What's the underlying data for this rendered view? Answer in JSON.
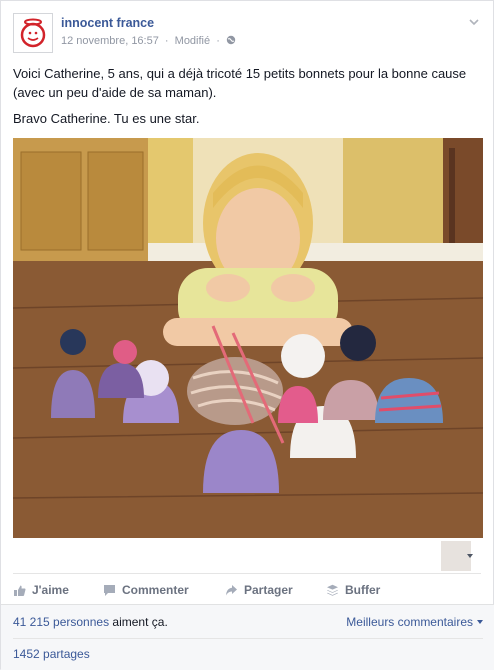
{
  "post": {
    "page_name": "innocent france",
    "timestamp": "12 novembre, 16:57",
    "separator": "·",
    "edited": "Modifié",
    "text_lines": [
      "Voici Catherine, 5 ans, qui a déjà tricoté 15 petits bonnets pour la bonne cause (avec un peu d'aide de sa maman).",
      "Bravo Catherine. Tu es une star."
    ]
  },
  "actions": [
    {
      "label": "J'aime",
      "icon": "thumbs-up-icon"
    },
    {
      "label": "Commenter",
      "icon": "comment-icon"
    },
    {
      "label": "Partager",
      "icon": "share-arrow-icon"
    },
    {
      "label": "Buffer",
      "icon": "buffer-icon"
    }
  ],
  "footer": {
    "likes_count": "41 215 personnes",
    "likes_suffix": " aiment ça.",
    "comments_sort": "Meilleurs commentaires",
    "shares": "1452 partages"
  },
  "colors": {
    "link": "#3b5998",
    "brand_red": "#d2232a"
  }
}
